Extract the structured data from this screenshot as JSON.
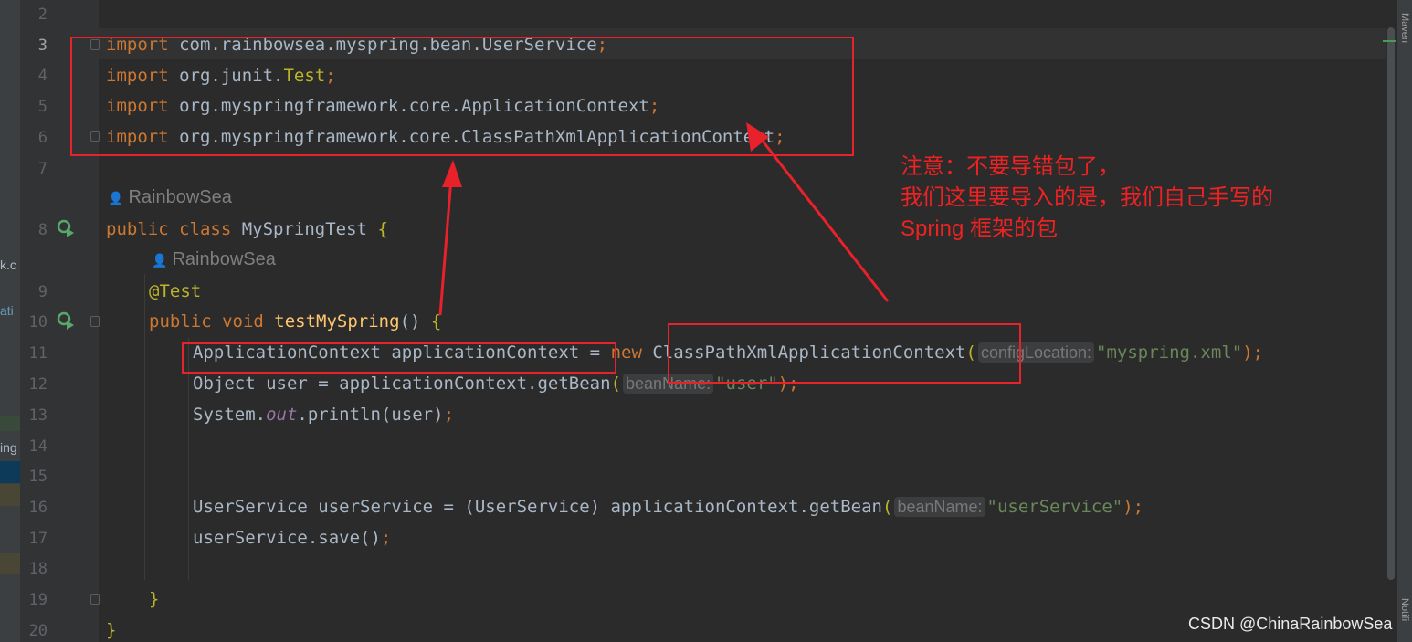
{
  "editor": {
    "line_numbers": [
      "2",
      "3",
      "4",
      "5",
      "6",
      "7",
      "8",
      "9",
      "10",
      "11",
      "12",
      "13",
      "14",
      "15",
      "16",
      "17",
      "18",
      "19",
      "20"
    ],
    "current_line": "3",
    "lines": {
      "l3": {
        "kw": "import",
        "pre": " com.rainbowsea.myspring.bean.",
        "cls": "UserService",
        "semi": ";"
      },
      "l4": {
        "kw": "import",
        "pre": " org.junit.",
        "cls": "Test",
        "semi": ";"
      },
      "l5": {
        "kw": "import",
        "pre": " org.myspringframework.core.",
        "cls": "ApplicationContext",
        "semi": ";"
      },
      "l6": {
        "kw": "import",
        "pre": " org.myspringframework.core.",
        "cls": "ClassPathXmlApplicationContext",
        "semi": ";"
      },
      "l8": {
        "kw": "public class",
        "name": " MySpringTest ",
        "brace": "{"
      },
      "l9": {
        "annotation": "@Test"
      },
      "l10": {
        "kw": "public void ",
        "method": "testMySpring",
        "rest": "() ",
        "brace": "{"
      },
      "l11": {
        "a": "ApplicationContext applicationContext = ",
        "kw": "new",
        "b": " ClassPathXmlApplicationContext",
        "paren": "(",
        "hint": "configLocation:",
        "str": "\"myspring.xml\"",
        "end": ");"
      },
      "l12": {
        "a": "Object user = applicationContext.getBean",
        "paren": "(",
        "hint": "beanName:",
        "str": "\"user\"",
        "end": ");"
      },
      "l13": {
        "a": "System.",
        "field": "out",
        "b": ".println(user)",
        "end": ";"
      },
      "l16": {
        "a": "UserService userService = (UserService) applicationContext.getBean",
        "paren": "(",
        "hint": "beanName:",
        "str": "\"userService\"",
        "end": ");"
      },
      "l17": {
        "a": "userService.save()",
        "end": ";"
      },
      "l19": {
        "brace": "}"
      },
      "l20": {
        "brace": "}"
      }
    },
    "authors": {
      "class_author": "RainbowSea",
      "method_author": "RainbowSea",
      "person_icon": "person-icon"
    }
  },
  "left_panel": {
    "fragments": [
      "k.c",
      "ati",
      "ing"
    ]
  },
  "right_panel": {
    "maven": "Maven",
    "notifications": "Notifi"
  },
  "annotation_note": {
    "text": "注意：不要导错包了，\n我们这里要导入的是，我们自己手写的\nSpring 框架的包",
    "color": "#e8212b"
  },
  "watermark": "CSDN @ChinaRainbowSea"
}
